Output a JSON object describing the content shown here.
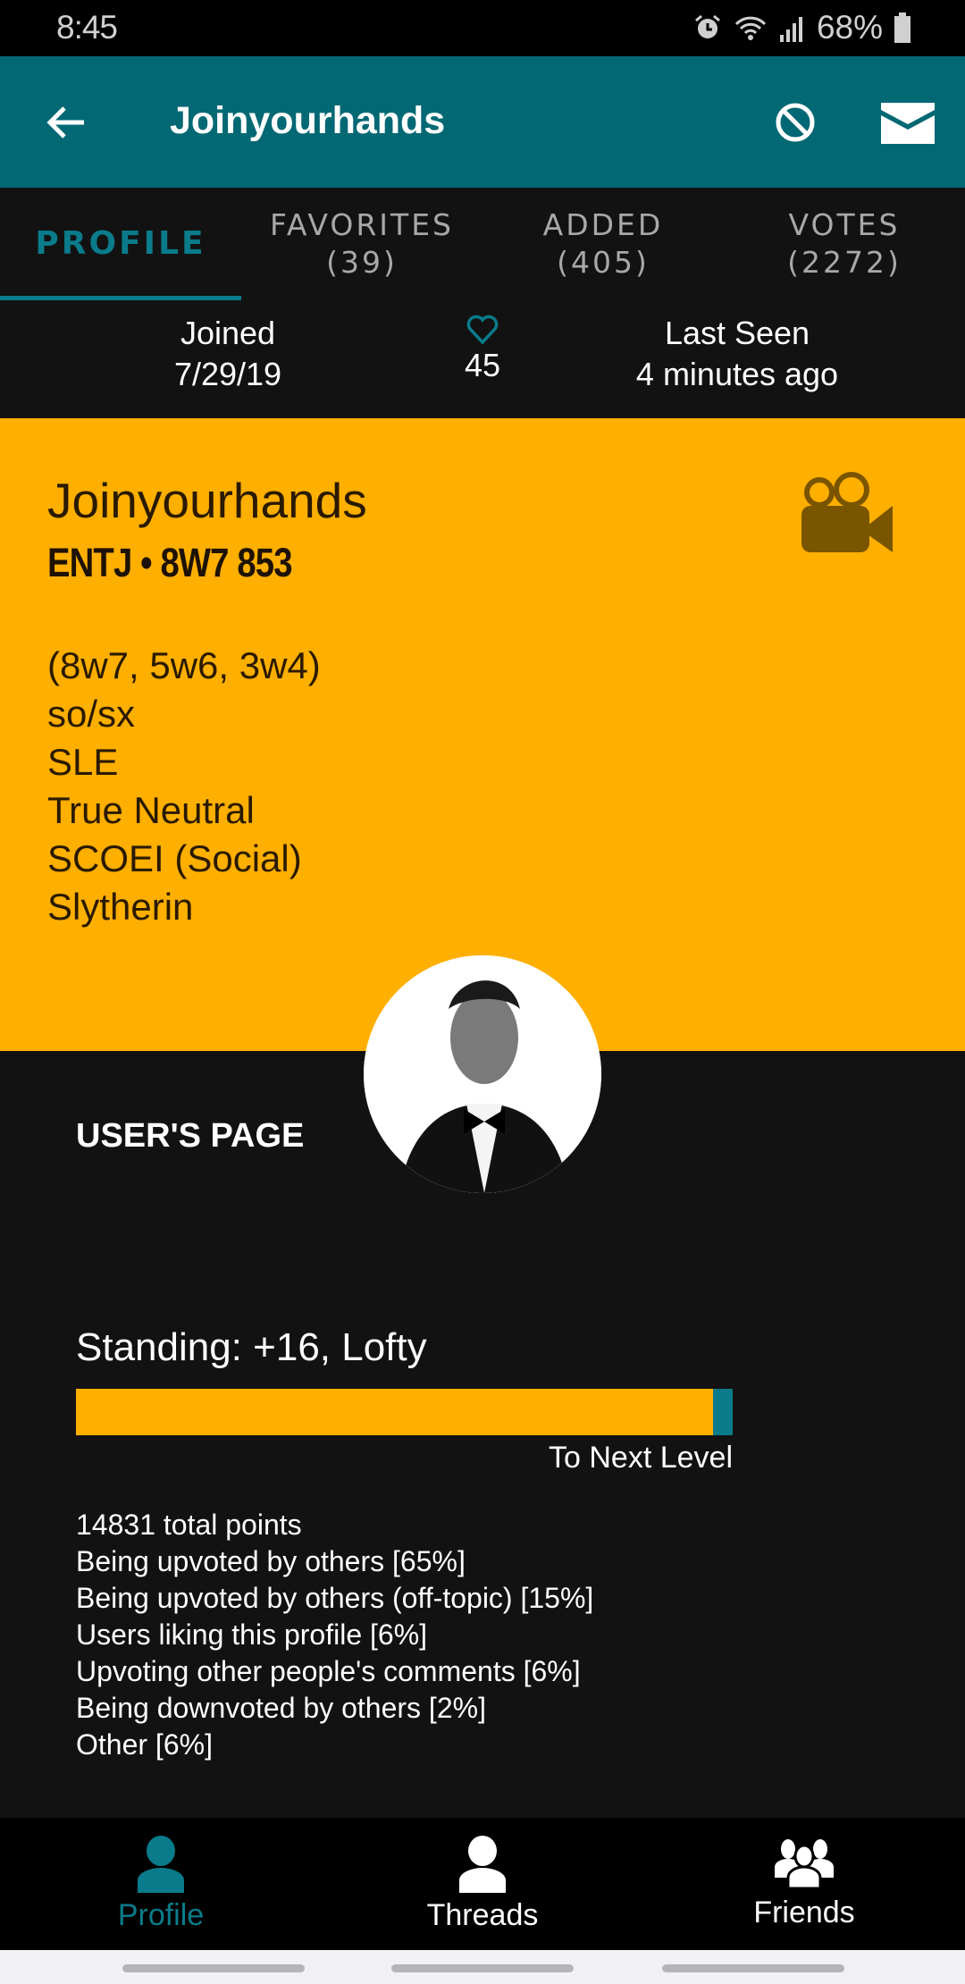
{
  "status_bar": {
    "time": "8:45",
    "battery": "68%",
    "icons": [
      "alarm-icon",
      "wifi-icon",
      "signal-icon",
      "battery-icon"
    ]
  },
  "app_bar": {
    "title": "Joinyourhands",
    "back_icon": "arrow-left-icon",
    "block_icon": "block-icon",
    "mail_icon": "mail-icon"
  },
  "tabs": [
    {
      "label": "PROFILE",
      "count": ""
    },
    {
      "label": "FAVORITES",
      "count": "(39)"
    },
    {
      "label": "ADDED",
      "count": "(405)"
    },
    {
      "label": "VOTES",
      "count": "(2272)"
    }
  ],
  "stats": {
    "joined_label": "Joined",
    "joined_value": "7/29/19",
    "likes_value": "45",
    "last_seen_label": "Last Seen",
    "last_seen_value": "4 minutes ago"
  },
  "profile": {
    "name": "Joinyourhands",
    "type": "ENTJ • 8W7 853",
    "traits": [
      "(8w7, 5w6, 3w4)",
      "so/sx",
      "SLE",
      "True Neutral",
      "SCOEI (Social)",
      "Slytherin"
    ]
  },
  "users_page_label": "USER'S PAGE",
  "standing": {
    "text": "Standing: +16, Lofty",
    "progress_percent": 97,
    "next_level_label": "To Next Level"
  },
  "points": {
    "total": "14831 total points",
    "breakdown": [
      "Being upvoted by others [65%]",
      "Being upvoted by others (off-topic) [15%]",
      "Users liking this profile [6%]",
      "Upvoting other people's comments [6%]",
      "Being downvoted by others [2%]",
      "Other [6%]"
    ]
  },
  "bottom_nav": [
    {
      "label": "Profile",
      "icon": "person-icon"
    },
    {
      "label": "Threads",
      "icon": "person-icon"
    },
    {
      "label": "Friends",
      "icon": "group-icon"
    }
  ],
  "colors": {
    "accent_teal": "#0a7b8a",
    "header_teal": "#026874",
    "orange": "#ffaf00",
    "background": "#121212"
  }
}
